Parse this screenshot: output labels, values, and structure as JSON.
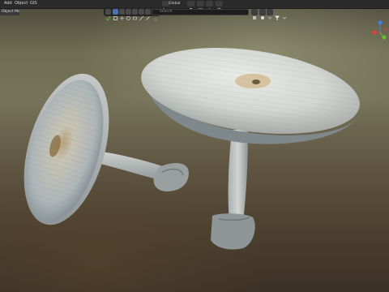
{
  "menu": {
    "items": [
      "Add",
      "Object",
      "GIS"
    ]
  },
  "header": {
    "mode_label": "Object Mode",
    "transform_label": "Global",
    "search_placeholder": "Search"
  },
  "icons": {
    "transform": "transform-orientation-icon",
    "pivot": "pivot-icon",
    "snap": "snap-icon",
    "proportional": "proportional-edit-icon",
    "filter": "filter-icon",
    "search": "search-icon",
    "gizmo": "navigation-gizmo-icon"
  },
  "colors": {
    "active_tool": "#4772b3",
    "gizmo_x": "#e0423f",
    "gizmo_y": "#6bb833",
    "gizmo_z": "#3f7fe0"
  }
}
